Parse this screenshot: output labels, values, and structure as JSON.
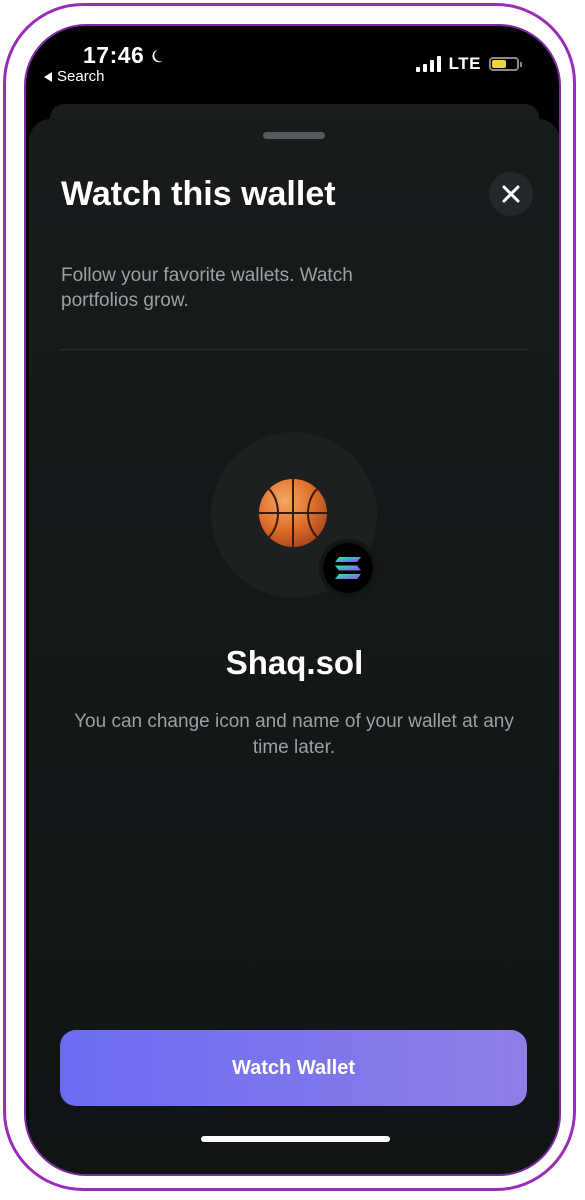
{
  "status_bar": {
    "time": "17:46",
    "back_label": "Search",
    "network": "LTE"
  },
  "sheet": {
    "title": "Watch this wallet",
    "subtitle": "Follow your favorite wallets. Watch portfolios grow."
  },
  "wallet": {
    "name": "Shaq.sol",
    "hint": "You can change icon and name of your wallet at any time later.",
    "avatar_icon": "basketball-icon",
    "chain_icon": "solana-icon"
  },
  "actions": {
    "watch_label": "Watch Wallet",
    "close_icon": "close-icon"
  },
  "colors": {
    "button_gradient_start": "#6b6cf3",
    "button_gradient_end": "#8e7ee6",
    "sheet_background": "#181b1c",
    "battery": "#f2d23a"
  }
}
